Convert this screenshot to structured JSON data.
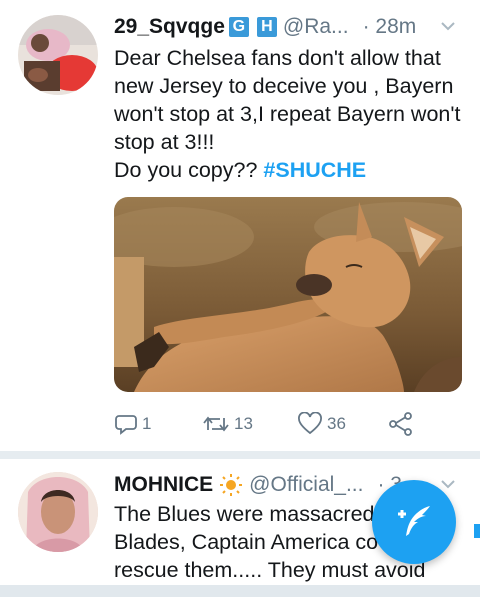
{
  "tweets": [
    {
      "display_name": "29_Sqvqge",
      "badges": [
        "G",
        "H"
      ],
      "handle": "@Ra...",
      "time": "· 28m",
      "lines": [
        "Dear Chelsea fans don't allow that",
        "new Jersey to deceive you , Bayern",
        "won't stop at 3,I repeat Bayern won't",
        "stop at 3!!!"
      ],
      "last_line_text": "Do you copy?? ",
      "hashtag": "#SHUCHE",
      "media_icon": "kangaroo-photo",
      "actions": {
        "reply_count": "1",
        "retweet_count": "13",
        "like_count": "36"
      }
    },
    {
      "display_name": "MOHNICE",
      "name_emoji": "sun-icon",
      "handle": "@Official_...",
      "time": "· 3",
      "lines": [
        "The Blues were massacred",
        "Blades, Captain America co",
        "rescue them..... They must avoid"
      ]
    }
  ],
  "colors": {
    "accent": "#1da1f2",
    "badge": "#3a9ad9",
    "secondary_text": "#657786",
    "divider": "#e6ecf0"
  },
  "fab": {
    "icon": "compose-tweet-icon"
  }
}
